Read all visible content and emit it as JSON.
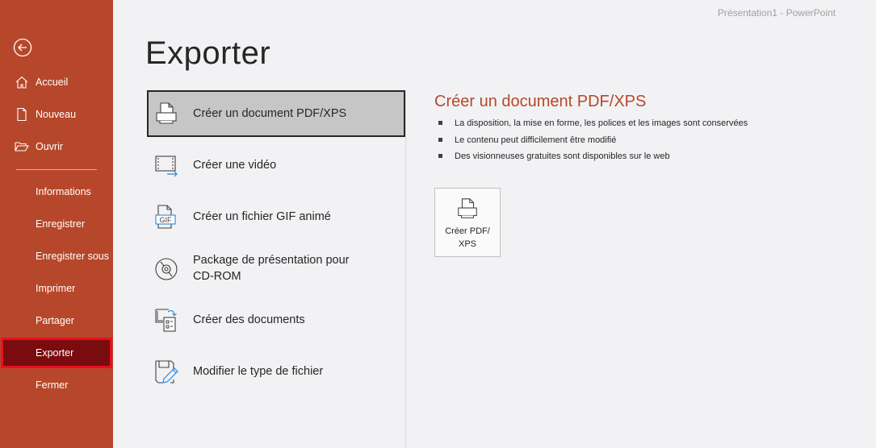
{
  "window": {
    "title": "Présentation1  -  PowerPoint"
  },
  "sidebar": {
    "back_icon": "back-arrow-icon",
    "top_items": [
      {
        "label": "Accueil",
        "icon": "home-icon"
      },
      {
        "label": "Nouveau",
        "icon": "new-document-icon"
      },
      {
        "label": "Ouvrir",
        "icon": "folder-open-icon"
      }
    ],
    "items": [
      {
        "label": "Informations"
      },
      {
        "label": "Enregistrer"
      },
      {
        "label": "Enregistrer sous"
      },
      {
        "label": "Imprimer"
      },
      {
        "label": "Partager"
      },
      {
        "label": "Exporter",
        "active": true
      },
      {
        "label": "Fermer"
      }
    ],
    "colors": {
      "background": "#b7472a",
      "active": "#7a0b0f",
      "active_outline": "#e8101c"
    }
  },
  "main": {
    "title": "Exporter",
    "options": [
      {
        "label": "Créer un document PDF/XPS",
        "icon": "pdf-printer-icon",
        "selected": true
      },
      {
        "label": "Créer une vidéo",
        "icon": "video-export-icon"
      },
      {
        "label": "Créer un fichier GIF animé",
        "icon": "gif-file-icon"
      },
      {
        "label_line1": "Package de présentation pour",
        "label_line2": "CD-ROM",
        "icon": "cd-rom-icon"
      },
      {
        "label": "Créer des documents",
        "icon": "handouts-icon"
      },
      {
        "label": "Modifier le type de fichier",
        "icon": "change-file-type-icon"
      }
    ]
  },
  "detail": {
    "title": "Créer un document PDF/XPS",
    "bullets": [
      "La disposition, la mise en forme, les polices et les images sont conservées",
      "Le contenu peut difficilement être modifié",
      "Des visionneuses gratuites sont disponibles sur le web"
    ],
    "button": {
      "label_line1": "Créer PDF/",
      "label_line2": "XPS",
      "icon": "pdf-printer-icon"
    },
    "accent_color": "#b7472a"
  }
}
